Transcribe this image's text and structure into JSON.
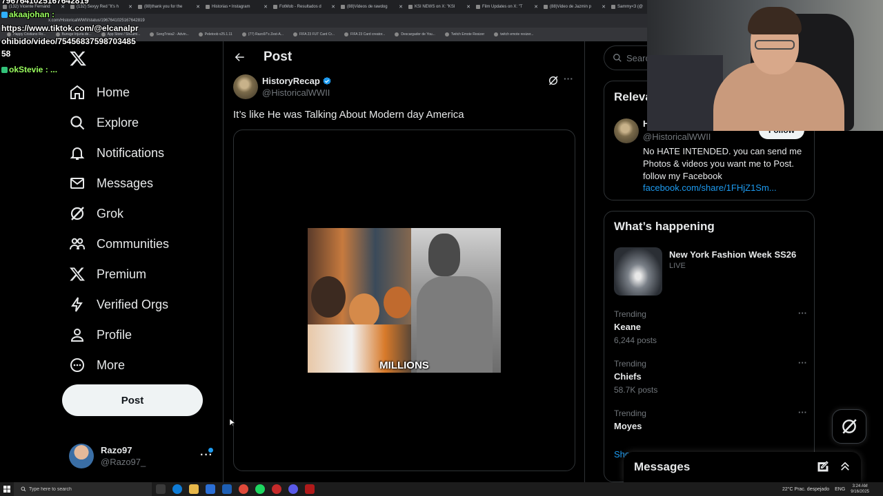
{
  "browser": {
    "tabs": [
      {
        "label": "(132) Vicente Fernánd"
      },
      {
        "label": "(132) Sexyy Red \"It's h"
      },
      {
        "label": "(88)thank you for the"
      },
      {
        "label": "Historias • Instagram"
      },
      {
        "label": "FotMob - Resultados d"
      },
      {
        "label": "(88)Videos de rawdog"
      },
      {
        "label": "KSI NEWS on X: \"KSI"
      },
      {
        "label": "Film Updates on X: \"T"
      },
      {
        "label": "(88)Video de Jazmin p"
      },
      {
        "label": "Sammy<3 (@"
      }
    ],
    "url": "x.com/HistoricalWWII/status/1967641025167642819",
    "bookmarks": [
      "Happy Cristiano Ro...",
      "Bunsge Injuria de...",
      "App Store / Streami...",
      "SongTrivia2 - Advin...",
      "Peletoob v25.1.11",
      "(77) Razo97's Zest-A...",
      "FIFA 23 FUT Card Cr...",
      "FIFA 23 Card creator...",
      "Descargador de You...",
      "Twitch Emote Resizer",
      "twitch emote resizer..."
    ]
  },
  "overlay": {
    "line1": "7967641025167642819",
    "user1": "akaajohan :",
    "line2": "https://www.tiktok.com/@elcanalpr",
    "line3": "ohibido/video/75456837598703485",
    "line4": "58",
    "user2": "okStevie : ..."
  },
  "nav": {
    "items": [
      {
        "label": "Home",
        "icon": "home-icon"
      },
      {
        "label": "Explore",
        "icon": "search-icon"
      },
      {
        "label": "Notifications",
        "icon": "bell-icon"
      },
      {
        "label": "Messages",
        "icon": "envelope-icon"
      },
      {
        "label": "Grok",
        "icon": "grok-icon"
      },
      {
        "label": "Communities",
        "icon": "people-icon"
      },
      {
        "label": "Premium",
        "icon": "x-logo-icon"
      },
      {
        "label": "Verified Orgs",
        "icon": "lightning-icon"
      },
      {
        "label": "Profile",
        "icon": "person-icon"
      },
      {
        "label": "More",
        "icon": "more-circle-icon"
      }
    ],
    "post_label": "Post"
  },
  "account": {
    "name": "Razo97",
    "handle": "@Razo97_",
    "more": "···"
  },
  "post": {
    "header_title": "Post",
    "author_name": "HistoryRecap",
    "author_handle": "@HistoricalWWII",
    "text": "It’s like He was Talking About Modern day America",
    "video_caption": "MILLIONS",
    "more": "···"
  },
  "sidebar": {
    "search_placeholder": "Search",
    "relevant_title": "Relevant people",
    "relevant": {
      "name": "H",
      "handle": "@HistoricalWWII",
      "follow_label": "Follow",
      "bio": "No HATE INTENDED. you can send me Photos & videos you want me to Post. follow my Facebook",
      "link": "facebook.com/share/1FHjZ1Sm..."
    },
    "happening_title": "What’s happening",
    "happening_head": "New York Fashion Week SS26",
    "happening_live": "LIVE",
    "trends": [
      {
        "label": "Trending",
        "name": "Keane",
        "count": "6,244 posts"
      },
      {
        "label": "Trending",
        "name": "Chiefs",
        "count": "58.7K posts"
      },
      {
        "label": "Trending",
        "name": "Moyes",
        "count": ""
      }
    ],
    "trend_more": "···",
    "show_more": "Show more"
  },
  "messages_drawer": {
    "title": "Messages"
  },
  "taskbar": {
    "search_placeholder": "Type here to search",
    "weather": "22°C  Prac. despejado",
    "lang": "ENG",
    "time": "3:24 AM",
    "date": "9/16/2025"
  },
  "colors": {
    "accent": "#1d9bf0",
    "background": "#000000",
    "text": "#e7e9ea",
    "muted": "#71767b"
  }
}
